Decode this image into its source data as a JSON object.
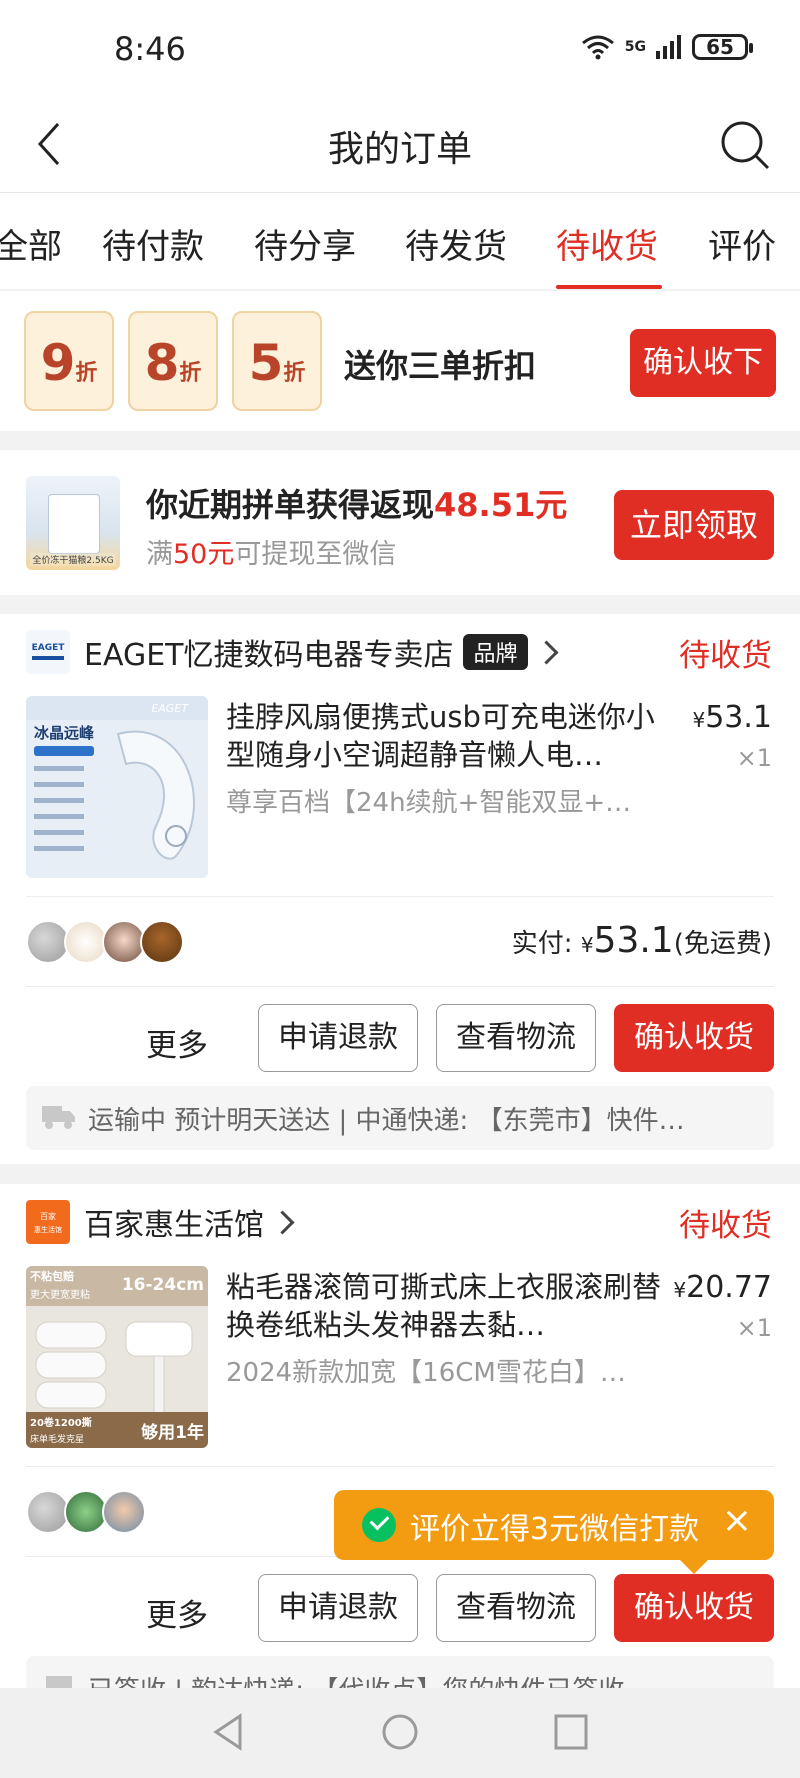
{
  "status_bar": {
    "time": "8:46",
    "network": "5G",
    "battery": "65"
  },
  "header": {
    "title": "我的订单"
  },
  "tabs": [
    {
      "label": "全部"
    },
    {
      "label": "待付款"
    },
    {
      "label": "待分享"
    },
    {
      "label": "待发货"
    },
    {
      "label": "待收货",
      "active": true
    },
    {
      "label": "评价"
    }
  ],
  "discount_banner": {
    "coupons": [
      {
        "num": "9",
        "unit": "折"
      },
      {
        "num": "8",
        "unit": "折"
      },
      {
        "num": "5",
        "unit": "折"
      }
    ],
    "text": "送你三单折扣",
    "button": "确认收下"
  },
  "cashback": {
    "thumb_label": "全价冻干猫粮2.5KG",
    "line1_prefix": "你近期拼单获得返现",
    "line1_amount": "48.51元",
    "line2_prefix": "满",
    "line2_amount": "50元",
    "line2_suffix": "可提现至微信",
    "button": "立即领取"
  },
  "orders": [
    {
      "store": "EAGET忆捷数码电器专卖店",
      "badge": "品牌",
      "status": "待收货",
      "product_title": "挂脖风扇便携式usb可充电迷你小型随身小空调超静音懒人电…",
      "product_spec": "尊享百档【24h续航+智能双显+…",
      "image_label": "冰晶远峰",
      "image_brand": "EAGET",
      "price_symbol": "¥",
      "price": "53.1",
      "qty": "×1",
      "paid_label": "实付:",
      "paid_symbol": "¥",
      "paid_amount": "53.1",
      "paid_note": "(免运费)",
      "more": "更多",
      "refund": "申请退款",
      "logistics_btn": "查看物流",
      "confirm": "确认收货",
      "logistics_text": "运输中 预计明天送达 | 中通快递: 【东莞市】快件…"
    },
    {
      "store": "百家惠生活馆",
      "store_logo_text": "百家惠生活馆",
      "status": "待收货",
      "product_title": "粘毛器滚筒可撕式床上衣服滚刷替换卷纸粘头发神器去黏…",
      "product_spec": "2024新款加宽【16CM雪花白】…",
      "image_label_top": "不粘包赔",
      "image_label_size": "16-24cm",
      "image_label_sub": "更大更宽更粘",
      "image_label_bottom": "20卷1200撕",
      "image_label_bottom2": "床单毛发克星",
      "image_label_enough": "够用1年",
      "price_symbol": "¥",
      "price": "20.77",
      "qty": "×1",
      "more": "更多",
      "refund": "申请退款",
      "logistics_btn": "查看物流",
      "confirm": "确认收货",
      "logistics_text": "已签收 | 韵达快递: 【代收点】您的快件已签收"
    }
  ],
  "tooltip": {
    "text": "评价立得3元微信打款",
    "close": "×"
  },
  "colors": {
    "accent": "#e02e24",
    "tooltip": "#f39c12",
    "wechat_green": "#07c160"
  }
}
